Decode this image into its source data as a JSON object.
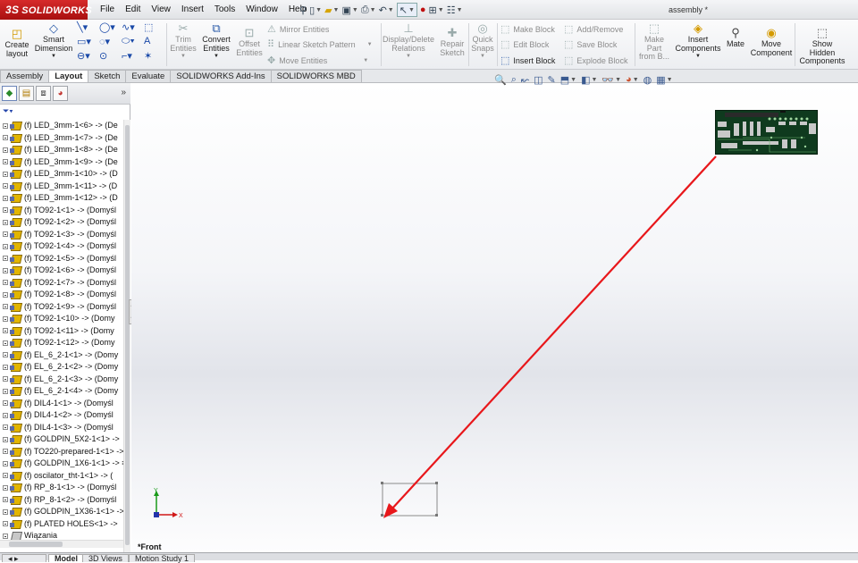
{
  "app": {
    "brand": "SOLIDWORKS",
    "brand_mark": "3S",
    "document_title": "assembly *"
  },
  "menu": [
    "File",
    "Edit",
    "View",
    "Insert",
    "Tools",
    "Window",
    "Help"
  ],
  "ribbon": {
    "create_layout": "Create\nlayout",
    "smart_dimension": "Smart\nDimension",
    "trim_entities": "Trim\nEntities",
    "convert_entities": "Convert\nEntities",
    "offset_entities": "Offset\nEntities",
    "mirror_entities": "Mirror Entities",
    "linear_sketch_pattern": "Linear Sketch Pattern",
    "move_entities": "Move Entities",
    "display_delete_relations": "Display/Delete\nRelations",
    "repair_sketch": "Repair\nSketch",
    "quick_snaps": "Quick\nSnaps",
    "make_block": "Make Block",
    "edit_block": "Edit Block",
    "insert_block": "Insert Block",
    "add_remove": "Add/Remove",
    "save_block": "Save Block",
    "explode_block": "Explode Block",
    "make_part_from_block": "Make\nPart\nfrom B...",
    "insert_components": "Insert\nComponents",
    "mate": "Mate",
    "move_component": "Move\nComponent",
    "show_hidden_components": "Show\nHidden\nComponents"
  },
  "command_tabs": [
    "Assembly",
    "Layout",
    "Sketch",
    "Evaluate",
    "SOLIDWORKS Add-Ins",
    "SOLIDWORKS MBD"
  ],
  "active_command_tab": "Layout",
  "feature_tree": {
    "items": [
      "(f) LED_3mm-1<6> -> (De",
      "(f) LED_3mm-1<7> -> (De",
      "(f) LED_3mm-1<8> -> (De",
      "(f) LED_3mm-1<9> -> (De",
      "(f) LED_3mm-1<10> -> (D",
      "(f) LED_3mm-1<11> -> (D",
      "(f) LED_3mm-1<12> -> (D",
      "(f) TO92-1<1> -> (Domyśl",
      "(f) TO92-1<2> -> (Domyśl",
      "(f) TO92-1<3> -> (Domyśl",
      "(f) TO92-1<4> -> (Domyśl",
      "(f) TO92-1<5> -> (Domyśl",
      "(f) TO92-1<6> -> (Domyśl",
      "(f) TO92-1<7> -> (Domyśl",
      "(f) TO92-1<8> -> (Domyśl",
      "(f) TO92-1<9> -> (Domyśl",
      "(f) TO92-1<10> -> (Domy",
      "(f) TO92-1<11> -> (Domy",
      "(f) TO92-1<12> -> (Domy",
      "(f) EL_6_2-1<1> -> (Domy",
      "(f) EL_6_2-1<2> -> (Domy",
      "(f) EL_6_2-1<3> -> (Domy",
      "(f) EL_6_2-1<4> -> (Domy",
      "(f) DIL4-1<1> -> (Domyśl",
      "(f) DIL4-1<2> -> (Domyśl",
      "(f) DIL4-1<3> -> (Domyśl",
      "(f) GOLDPIN_5X2-1<1> ->",
      "(f) TO220-prepared-1<1> ->",
      "(f) GOLDPIN_1X6-1<1> -> ≡",
      "(f) oscilator_tht-1<1> -> (",
      "(f) RP_8-1<1> -> (Domyśl",
      "(f) RP_8-1<2> -> (Domyśl",
      "(f) GOLDPIN_1X36-1<1> ->",
      "(f) PLATED HOLES<1> ->"
    ],
    "mates_label": "Wiązania"
  },
  "viewport": {
    "view_label": "*Front",
    "triad_y": "Y",
    "triad_x": "X"
  },
  "bottom_tabs": [
    "Model",
    "3D Views",
    "Motion Study 1"
  ],
  "colors": {
    "brand_red": "#c01a1a",
    "annotation_arrow": "#e8171b"
  }
}
